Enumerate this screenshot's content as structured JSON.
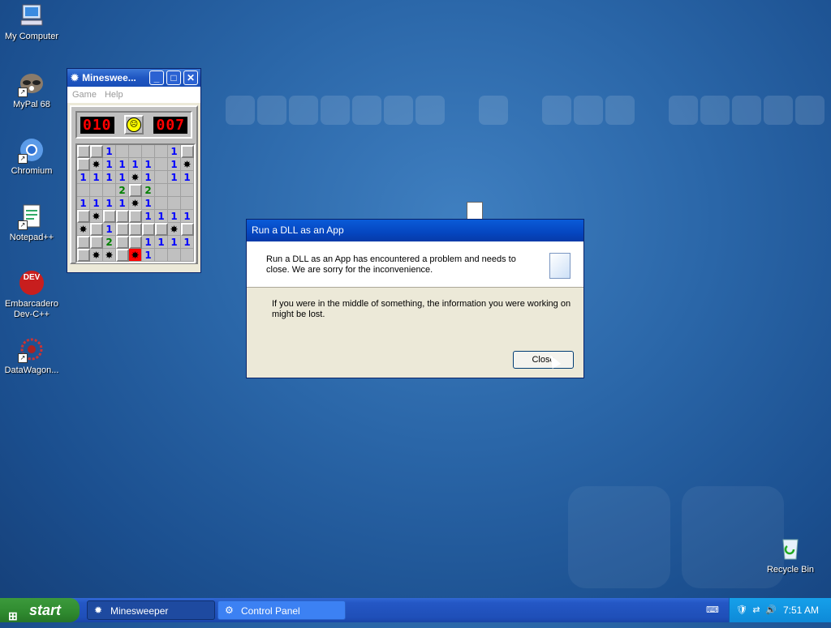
{
  "desktop_icons": [
    {
      "label": "My Computer",
      "icon": "computer-icon"
    },
    {
      "label": "MyPal 68",
      "icon": "raccoon-icon"
    },
    {
      "label": "Chromium",
      "icon": "chromium-icon"
    },
    {
      "label": "Notepad++",
      "icon": "notepad-icon"
    },
    {
      "label": "Embarcadero Dev-C++",
      "icon": "devcpp-icon",
      "badge": "DEV"
    },
    {
      "label": "DataWagon...",
      "icon": "datawagon-icon"
    },
    {
      "label": "Recycle Bin",
      "icon": "recycle-bin-icon"
    }
  ],
  "minesweeper": {
    "title": "Minesweе...",
    "menu": [
      "Game",
      "Help"
    ],
    "mine_counter": "010",
    "timer": "007",
    "face": "☹",
    "grid": [
      [
        "r",
        "r",
        "1",
        "",
        "",
        "",
        "",
        "1",
        "r"
      ],
      [
        "r",
        "*",
        "1",
        "1",
        "1",
        "1",
        "",
        "1",
        "*"
      ],
      [
        "1",
        "1",
        "1",
        "1",
        "*",
        "1",
        "",
        "1",
        "1"
      ],
      [
        "",
        "",
        "",
        "2",
        "r",
        "2",
        "",
        "",
        ""
      ],
      [
        "1",
        "1",
        "1",
        "1",
        "*",
        "1",
        "",
        "",
        ""
      ],
      [
        "r",
        "*",
        "r",
        "r",
        "r",
        "1",
        "1",
        "1",
        "1"
      ],
      [
        "*",
        "r",
        "1",
        "r",
        "r",
        "r",
        "r",
        "*",
        "r"
      ],
      [
        "r",
        "r",
        "2",
        "r",
        "r",
        "1",
        "1",
        "1",
        "1"
      ],
      [
        "r",
        "*",
        "*",
        "r",
        "X",
        "1",
        "",
        "",
        ""
      ]
    ]
  },
  "dialog": {
    "title": "Run a DLL as an App",
    "message": "Run a DLL as an App has encountered a problem and needs to close.  We are sorry for the inconvenience.",
    "info": "If you were in the middle of something, the information you were working on might be lost.",
    "close_label": "Close"
  },
  "taskbar": {
    "start_label": "start",
    "buttons": [
      {
        "label": "Minesweeper",
        "active": true
      },
      {
        "label": "Control Panel",
        "active": false
      }
    ],
    "clock": "7:51 AM"
  },
  "colors": {
    "desktop": "#2a66a8",
    "taskbar": "#2457c5",
    "start": "#2f8a2f",
    "title_bar": "#0a5bd8"
  }
}
